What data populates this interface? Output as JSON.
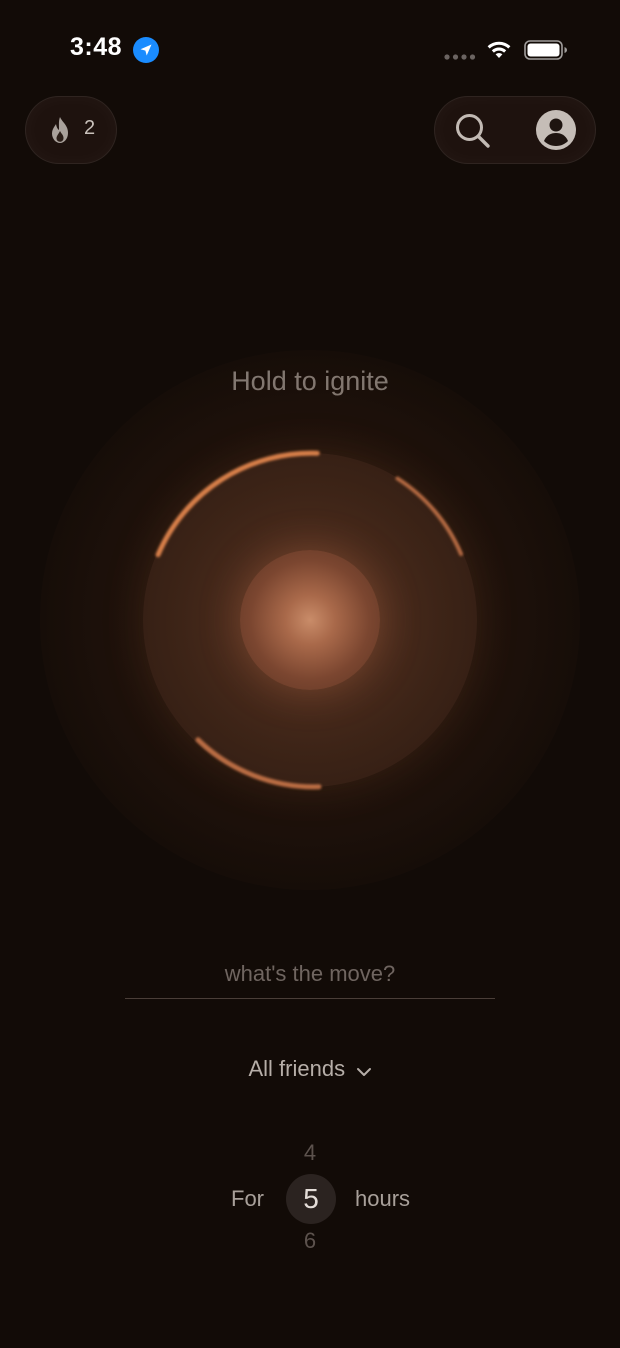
{
  "status_bar": {
    "time": "3:48",
    "icons": [
      "location-arrow-icon",
      "cellular-dots-icon",
      "wifi-icon",
      "battery-icon"
    ]
  },
  "header": {
    "streak_count": "2",
    "streak_icon": "flame-icon",
    "search_icon": "search-icon",
    "profile_icon": "profile-icon"
  },
  "main": {
    "prompt": "Hold to ignite",
    "accent_color": "#d77f4a"
  },
  "compose": {
    "placeholder": "what's the move?",
    "value": ""
  },
  "audience": {
    "label": "All friends",
    "icon": "chevron-down-icon"
  },
  "duration": {
    "prefix": "For",
    "suffix": "hours",
    "previous": "4",
    "current": "5",
    "next": "6"
  },
  "colors": {
    "background": "#120b07",
    "location_blue": "#1a8cff"
  }
}
